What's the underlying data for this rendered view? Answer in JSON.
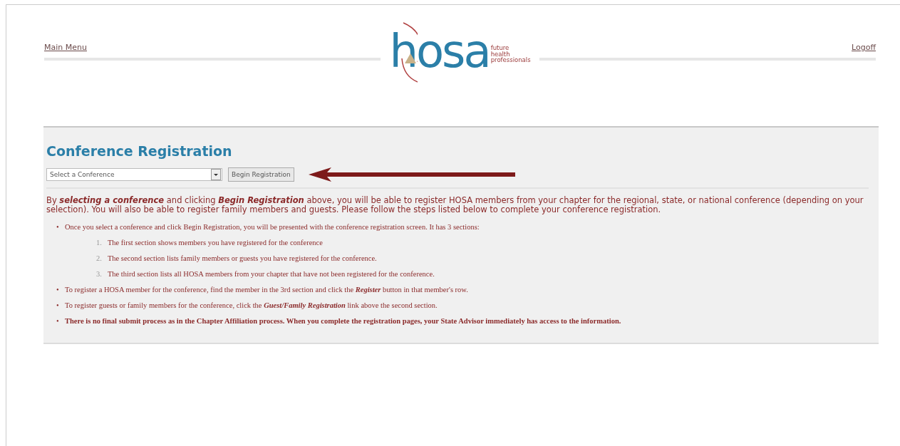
{
  "header": {
    "left_link": "Main Menu",
    "right_link": "Logoff",
    "logo": {
      "wordmark": "hosa",
      "tagline": [
        "future",
        "health",
        "professionals"
      ]
    }
  },
  "panel": {
    "title": "Conference Registration",
    "conference_select": {
      "value": "Select a Conference"
    },
    "begin_button": "Begin Registration",
    "intro": "By **selecting a conference** and clicking **Begin Registration** above, you will be able to register HOSA members from your chapter for the regional, state, or national conference (depending on your selection). You will also be able to register family members and guests. Please follow the steps listed below to complete your conference registration.",
    "steps": [
      {
        "kind": "step",
        "marker": "•",
        "text": "Once you select a conference and click Begin Registration, you will be presented with the conference registration screen. It has 3 sections:",
        "children": [
          {
            "number": "1.",
            "text": "The first section shows members you have registered for the conference"
          },
          {
            "number": "2.",
            "text": "The second section lists family members or guests you have registered for the conference."
          },
          {
            "number": "3.",
            "text": "The third section lists all HOSA members from your chapter that have not been registered for the conference."
          }
        ]
      },
      {
        "kind": "step",
        "marker": "•",
        "text": "To register a HOSA member for the conference, find the member in the 3rd section and click the **Register** button in that member's row."
      },
      {
        "kind": "step",
        "marker": "•",
        "text": "To register guests or family members for the conference, click the **Guest/Family Registration** link above the second section."
      },
      {
        "kind": "note",
        "marker": "•",
        "text": "There is no final submit process as in the Chapter Affiliation process. When you complete the registration pages, your State Advisor immediately has access to the information."
      }
    ]
  }
}
